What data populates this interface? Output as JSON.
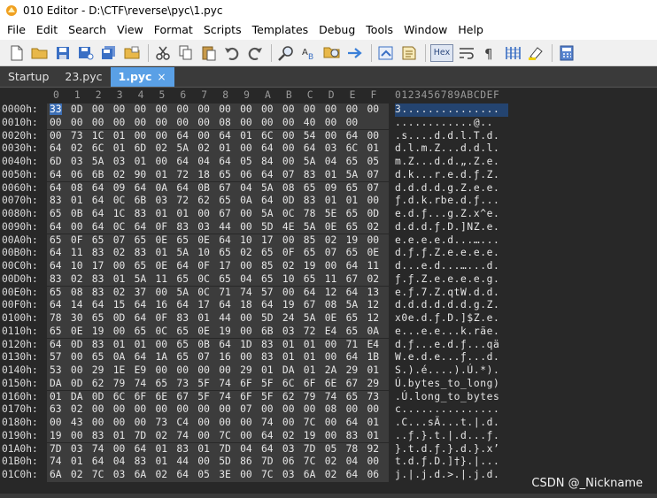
{
  "window": {
    "title": "010 Editor - D:\\CTF\\reverse\\pyc\\1.pyc"
  },
  "menu": [
    "File",
    "Edit",
    "Search",
    "View",
    "Format",
    "Scripts",
    "Templates",
    "Debug",
    "Tools",
    "Window",
    "Help"
  ],
  "toolbar": {
    "hex_label": "Hex",
    "icons": [
      "new-file-icon",
      "open-folder-icon",
      "save-icon",
      "save-as-icon",
      "save-all-icon",
      "close-file-icon",
      "cut-icon",
      "copy-icon",
      "paste-icon",
      "undo-icon",
      "redo-icon",
      "find-icon",
      "replace-icon",
      "find-in-files-icon",
      "goto-icon",
      "run-script-icon",
      "run-template-icon",
      "hex-mode-icon",
      "text-wrap-icon",
      "paragraph-icon",
      "columns-icon",
      "highlight-icon",
      "calculator-icon"
    ]
  },
  "tabs": [
    {
      "label": "Startup",
      "active": false
    },
    {
      "label": "23.pyc",
      "active": false
    },
    {
      "label": "1.pyc",
      "active": true,
      "close": "×"
    }
  ],
  "editor": {
    "col_headers": [
      "0",
      "1",
      "2",
      "3",
      "4",
      "5",
      "6",
      "7",
      "8",
      "9",
      "A",
      "B",
      "C",
      "D",
      "E",
      "F"
    ],
    "ascii_header": "0123456789ABCDEF",
    "rows": [
      {
        "addr": "0000h:",
        "bytes": [
          "33",
          "0D",
          "00",
          "00",
          "00",
          "00",
          "00",
          "00",
          "00",
          "00",
          "00",
          "00",
          "00",
          "00",
          "00",
          "00"
        ],
        "ascii": "3..............."
      },
      {
        "addr": "0010h:",
        "bytes": [
          "00",
          "00",
          "00",
          "00",
          "00",
          "00",
          "00",
          "00",
          "08",
          "00",
          "00",
          "00",
          "40",
          "00",
          "00",
          ""
        ],
        "ascii": "............@.."
      },
      {
        "addr": "0020h:",
        "bytes": [
          "00",
          "73",
          "1C",
          "01",
          "00",
          "00",
          "64",
          "00",
          "64",
          "01",
          "6C",
          "00",
          "54",
          "00",
          "64",
          "00"
        ],
        "ascii": ".s....d.d.l.T.d."
      },
      {
        "addr": "0030h:",
        "bytes": [
          "64",
          "02",
          "6C",
          "01",
          "6D",
          "02",
          "5A",
          "02",
          "01",
          "00",
          "64",
          "00",
          "64",
          "03",
          "6C",
          "01"
        ],
        "ascii": "d.l.m.Z...d.d.l."
      },
      {
        "addr": "0040h:",
        "bytes": [
          "6D",
          "03",
          "5A",
          "03",
          "01",
          "00",
          "64",
          "04",
          "64",
          "05",
          "84",
          "00",
          "5A",
          "04",
          "65",
          "05"
        ],
        "ascii": "m.Z...d.d.„.Z.e."
      },
      {
        "addr": "0050h:",
        "bytes": [
          "64",
          "06",
          "6B",
          "02",
          "90",
          "01",
          "72",
          "18",
          "65",
          "06",
          "64",
          "07",
          "83",
          "01",
          "5A",
          "07"
        ],
        "ascii": "d.k...r.e.d.ƒ.Z."
      },
      {
        "addr": "0060h:",
        "bytes": [
          "64",
          "08",
          "64",
          "09",
          "64",
          "0A",
          "64",
          "0B",
          "67",
          "04",
          "5A",
          "08",
          "65",
          "09",
          "65",
          "07"
        ],
        "ascii": "d.d.d.d.g.Z.e.e."
      },
      {
        "addr": "0070h:",
        "bytes": [
          "83",
          "01",
          "64",
          "0C",
          "6B",
          "03",
          "72",
          "62",
          "65",
          "0A",
          "64",
          "0D",
          "83",
          "01",
          "01",
          "00"
        ],
        "ascii": "ƒ.d.k.rbe.d.ƒ..."
      },
      {
        "addr": "0080h:",
        "bytes": [
          "65",
          "0B",
          "64",
          "1C",
          "83",
          "01",
          "01",
          "00",
          "67",
          "00",
          "5A",
          "0C",
          "78",
          "5E",
          "65",
          "0D"
        ],
        "ascii": "e.d.ƒ...g.Z.x^e."
      },
      {
        "addr": "0090h:",
        "bytes": [
          "64",
          "00",
          "64",
          "0C",
          "64",
          "0F",
          "83",
          "03",
          "44",
          "00",
          "5D",
          "4E",
          "5A",
          "0E",
          "65",
          "02"
        ],
        "ascii": "d.d.d.ƒ.D.]NZ.e."
      },
      {
        "addr": "00A0h:",
        "bytes": [
          "65",
          "0F",
          "65",
          "07",
          "65",
          "0E",
          "65",
          "0E",
          "64",
          "10",
          "17",
          "00",
          "85",
          "02",
          "19",
          "00"
        ],
        "ascii": "e.e.e.e.d...…..."
      },
      {
        "addr": "00B0h:",
        "bytes": [
          "64",
          "11",
          "83",
          "02",
          "83",
          "01",
          "5A",
          "10",
          "65",
          "02",
          "65",
          "0F",
          "65",
          "07",
          "65",
          "0E"
        ],
        "ascii": "d.ƒ.ƒ.Z.e.e.e.e."
      },
      {
        "addr": "00C0h:",
        "bytes": [
          "64",
          "10",
          "17",
          "00",
          "65",
          "0E",
          "64",
          "0F",
          "17",
          "00",
          "85",
          "02",
          "19",
          "00",
          "64",
          "11"
        ],
        "ascii": "d...e.d...…...d."
      },
      {
        "addr": "00D0h:",
        "bytes": [
          "83",
          "02",
          "83",
          "01",
          "5A",
          "11",
          "65",
          "0C",
          "65",
          "04",
          "65",
          "10",
          "65",
          "11",
          "67",
          "02"
        ],
        "ascii": "ƒ.ƒ.Z.e.e.e.e.g."
      },
      {
        "addr": "00E0h:",
        "bytes": [
          "65",
          "08",
          "83",
          "02",
          "37",
          "00",
          "5A",
          "0C",
          "71",
          "74",
          "57",
          "00",
          "64",
          "12",
          "64",
          "13"
        ],
        "ascii": "e.ƒ.7.Z.qtW.d.d."
      },
      {
        "addr": "00F0h:",
        "bytes": [
          "64",
          "14",
          "64",
          "15",
          "64",
          "16",
          "64",
          "17",
          "64",
          "18",
          "64",
          "19",
          "67",
          "08",
          "5A",
          "12"
        ],
        "ascii": "d.d.d.d.d.d.g.Z."
      },
      {
        "addr": "0100h:",
        "bytes": [
          "78",
          "30",
          "65",
          "0D",
          "64",
          "0F",
          "83",
          "01",
          "44",
          "00",
          "5D",
          "24",
          "5A",
          "0E",
          "65",
          "12"
        ],
        "ascii": "x0e.d.ƒ.D.]$Z.e."
      },
      {
        "addr": "0110h:",
        "bytes": [
          "65",
          "0E",
          "19",
          "00",
          "65",
          "0C",
          "65",
          "0E",
          "19",
          "00",
          "6B",
          "03",
          "72",
          "E4",
          "65",
          "0A"
        ],
        "ascii": "e...e.e...k.räe."
      },
      {
        "addr": "0120h:",
        "bytes": [
          "64",
          "0D",
          "83",
          "01",
          "01",
          "00",
          "65",
          "0B",
          "64",
          "1D",
          "83",
          "01",
          "01",
          "00",
          "71",
          "E4"
        ],
        "ascii": "d.ƒ...e.d.ƒ...qä"
      },
      {
        "addr": "0130h:",
        "bytes": [
          "57",
          "00",
          "65",
          "0A",
          "64",
          "1A",
          "65",
          "07",
          "16",
          "00",
          "83",
          "01",
          "01",
          "00",
          "64",
          "1B"
        ],
        "ascii": "W.e.d.e...ƒ...d."
      },
      {
        "addr": "0140h:",
        "bytes": [
          "53",
          "00",
          "29",
          "1E",
          "E9",
          "00",
          "00",
          "00",
          "00",
          "29",
          "01",
          "DA",
          "01",
          "2A",
          "29",
          "01"
        ],
        "ascii": "S.).é....).Ú.*)."
      },
      {
        "addr": "0150h:",
        "bytes": [
          "DA",
          "0D",
          "62",
          "79",
          "74",
          "65",
          "73",
          "5F",
          "74",
          "6F",
          "5F",
          "6C",
          "6F",
          "6E",
          "67",
          "29"
        ],
        "ascii": "Ú.bytes_to_long)"
      },
      {
        "addr": "0160h:",
        "bytes": [
          "01",
          "DA",
          "0D",
          "6C",
          "6F",
          "6E",
          "67",
          "5F",
          "74",
          "6F",
          "5F",
          "62",
          "79",
          "74",
          "65",
          "73"
        ],
        "ascii": ".Ú.long_to_bytes"
      },
      {
        "addr": "0170h:",
        "bytes": [
          "63",
          "02",
          "00",
          "00",
          "00",
          "00",
          "00",
          "00",
          "00",
          "07",
          "00",
          "00",
          "00",
          "08",
          "00",
          "00"
        ],
        "ascii": "c..............."
      },
      {
        "addr": "0180h:",
        "bytes": [
          "00",
          "43",
          "00",
          "00",
          "00",
          "73",
          "C4",
          "00",
          "00",
          "00",
          "74",
          "00",
          "7C",
          "00",
          "64",
          "01"
        ],
        "ascii": ".C...sÄ...t.|.d."
      },
      {
        "addr": "0190h:",
        "bytes": [
          "19",
          "00",
          "83",
          "01",
          "7D",
          "02",
          "74",
          "00",
          "7C",
          "00",
          "64",
          "02",
          "19",
          "00",
          "83",
          "01"
        ],
        "ascii": "..ƒ.}.t.|.d...ƒ."
      },
      {
        "addr": "01A0h:",
        "bytes": [
          "7D",
          "03",
          "74",
          "00",
          "64",
          "01",
          "83",
          "01",
          "7D",
          "04",
          "64",
          "03",
          "7D",
          "05",
          "78",
          "92"
        ],
        "ascii": "}.t.d.ƒ.}.d.}.x’"
      },
      {
        "addr": "01B0h:",
        "bytes": [
          "74",
          "01",
          "64",
          "04",
          "83",
          "01",
          "44",
          "00",
          "5D",
          "86",
          "7D",
          "06",
          "7C",
          "02",
          "04",
          "00"
        ],
        "ascii": "t.d.ƒ.D.]†}.|..."
      },
      {
        "addr": "01C0h:",
        "bytes": [
          "6A",
          "02",
          "7C",
          "03",
          "6A",
          "02",
          "64",
          "05",
          "3E",
          "00",
          "7C",
          "03",
          "6A",
          "02",
          "64",
          "06"
        ],
        "ascii": "j.|.j.d.>.|.j.d."
      }
    ]
  },
  "watermark": "CSDN @_Nickname"
}
